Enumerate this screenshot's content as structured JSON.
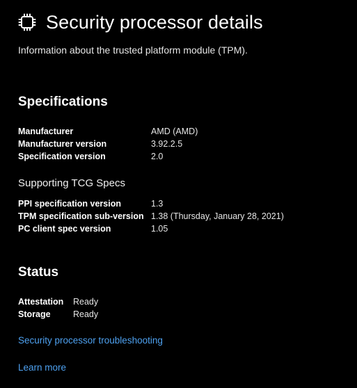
{
  "header": {
    "title": "Security processor details",
    "icon": "processor-chip-icon"
  },
  "subtitle": "Information about the trusted platform module (TPM).",
  "specifications": {
    "title": "Specifications",
    "rows": [
      {
        "key": "Manufacturer",
        "value": "AMD (AMD)"
      },
      {
        "key": "Manufacturer version",
        "value": "3.92.2.5"
      },
      {
        "key": "Specification version",
        "value": "2.0"
      }
    ]
  },
  "tcg": {
    "title": "Supporting TCG Specs",
    "rows": [
      {
        "key": "PPI specification version",
        "value": "1.3"
      },
      {
        "key": "TPM specification sub-version",
        "value": "1.38 (Thursday, January 28, 2021)"
      },
      {
        "key": "PC client spec version",
        "value": "1.05"
      }
    ]
  },
  "status": {
    "title": "Status",
    "rows": [
      {
        "key": "Attestation",
        "value": "Ready"
      },
      {
        "key": "Storage",
        "value": "Ready"
      }
    ]
  },
  "links": {
    "troubleshooting": "Security processor troubleshooting",
    "learn_more": "Learn more"
  },
  "colors": {
    "background": "#000000",
    "text": "#ffffff",
    "link": "#4ea1f0"
  }
}
